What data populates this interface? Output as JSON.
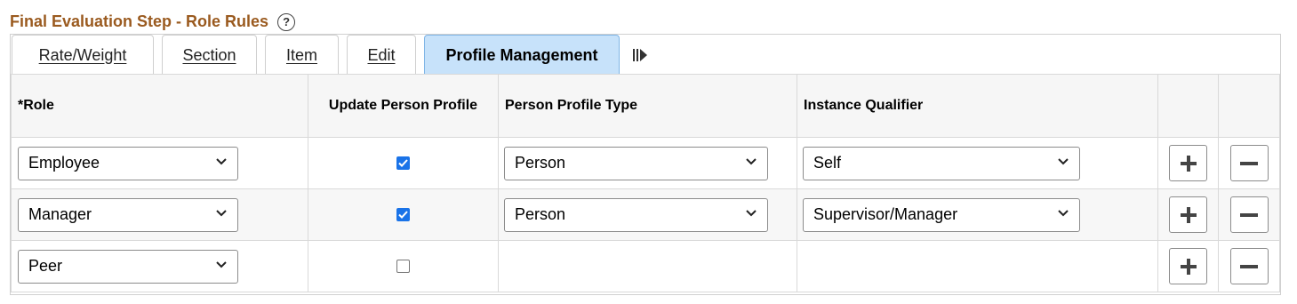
{
  "page": {
    "title": "Final Evaluation Step - Role Rules",
    "help_icon": "question-circle-icon"
  },
  "tabs": [
    {
      "label": "Rate/Weight",
      "active": false
    },
    {
      "label": "Section",
      "active": false
    },
    {
      "label": "Item",
      "active": false
    },
    {
      "label": "Edit",
      "active": false
    },
    {
      "label": "Profile Management",
      "active": true
    }
  ],
  "tabs_more_icon": "show-all-columns-icon",
  "grid": {
    "columns": [
      "*Role",
      "Update Person Profile",
      "Person Profile Type",
      "Instance Qualifier",
      "",
      ""
    ],
    "rows": [
      {
        "role": "Employee",
        "update_profile": true,
        "profile_type": "Person",
        "qualifier": "Self"
      },
      {
        "role": "Manager",
        "update_profile": true,
        "profile_type": "Person",
        "qualifier": "Supervisor/Manager"
      },
      {
        "role": "Peer",
        "update_profile": false,
        "profile_type": "",
        "qualifier": ""
      }
    ],
    "add_icon": "plus-icon",
    "delete_icon": "minus-icon"
  },
  "colors": {
    "title": "#9a5a1f",
    "active_tab_bg": "#c7e2fa",
    "checkbox_checked": "#1a73e8"
  }
}
